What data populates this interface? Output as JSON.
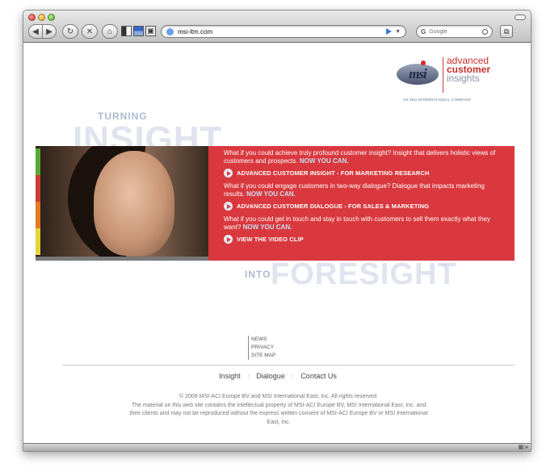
{
  "browser": {
    "url": "msi-ltm.com",
    "search_placeholder": "Google",
    "search_engine_glyph": "G",
    "nav_back_glyph": "◀",
    "nav_fwd_glyph": "▶",
    "reload_glyph": "↻",
    "stop_glyph": "✕",
    "home_glyph": "⌂"
  },
  "logo": {
    "mark": "msi",
    "line1": "advanced",
    "line2": "customer",
    "line3": "insights",
    "tagline": "AN MSI INTERNATIONAL COMPANY"
  },
  "hero": {
    "top_small": "TURNING",
    "top_big": "INSIGHT",
    "bottom_small": "INTO",
    "bottom_big": "FORESIGHT",
    "trademark": "TM",
    "strip_colors": [
      "#58a93b",
      "#cc3d36",
      "#e27b24",
      "#e4d63a"
    ],
    "banner_color": "#d9393e"
  },
  "banner": {
    "q1_text": "What if you could achieve truly profound customer insight? Insight that delivers holistic views of customers and prospects.",
    "q1_cta": "NOW YOU CAN.",
    "link1": "ADVANCED CUSTOMER INSIGHT - FOR MARKETING RESEARCH",
    "q2_text": "What if you could engage customers in two-way dialogue? Dialogue that impacts marketing results.",
    "q2_cta": "NOW YOU CAN.",
    "link2": "ADVANCED CUSTOMER DIALOGUE - FOR SALES & MARKETING",
    "q3_text": "What if you could get in touch and stay in touch with customers to sell them exactly what they want?",
    "q3_cta": "NOW YOU CAN.",
    "link3": "VIEW THE VIDEO CLIP"
  },
  "mini_links": [
    "NEWS",
    "PRIVACY",
    "SITE MAP"
  ],
  "main_nav": {
    "insight": "Insight",
    "dialogue": "Dialogue",
    "contact": "Contact Us",
    "separator": ":"
  },
  "footer": {
    "copyright": "© 2009 MSI-ACI Europe BV and MSI International East, Inc. All rights reserved.",
    "legal": "The material on this web site contains the intellectual property of MSI-ACI Europe BV, MSI International East, Inc. and their clients and may not be reproduced without the express written consent of MSI-ACI Europe BV or MSI International East, Inc."
  }
}
